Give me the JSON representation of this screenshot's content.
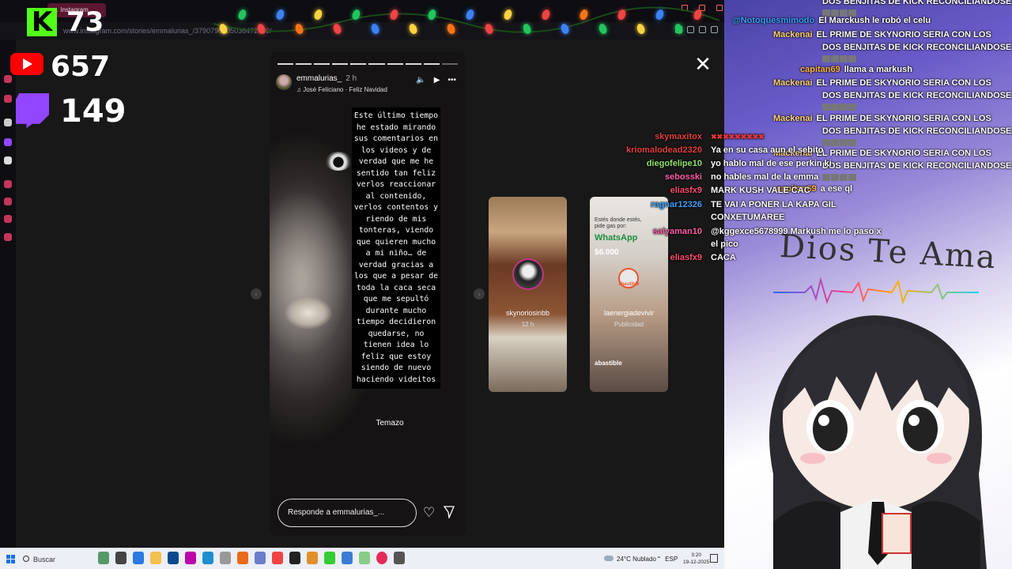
{
  "browser": {
    "tab_title": "… Instagram",
    "url": "www.instagram.com/stories/emmalurias_/3790790705036472569/"
  },
  "story": {
    "username": "emmalurias_",
    "time": "2 h",
    "music": "José Feliciano · Feliz Navidad",
    "caption": "Este último tiempo he estado mirando sus comentarios en los videos y de verdad que me he sentido tan feliz verlos reaccionar al contenido, verlos contentos y riendo de mis tonteras, viendo que quieren mucho a mi niño… de verdad gracias a los que a pesar de toda la caca seca que me sepultó durante mucho tiempo decidieron quedarse, no tienen idea lo feliz que estoy siendo de nuevo haciendo videitos",
    "tag_text": "Temazo",
    "reply_placeholder": "Responde a emmalurias_...",
    "progress_segments": 10,
    "progress_active": 9
  },
  "previews": [
    {
      "name": "skynoriosinbb",
      "sub": "12 h"
    },
    {
      "name": "laenergiadevivir",
      "sub": "Publicidad",
      "ad_small": "Estés donde estés, pide gas por:",
      "ad_title": "WhatsApp",
      "ad_brand": "abastible",
      "ad_price": "6.000",
      "ad_logo": "abastible"
    }
  ],
  "stream": {
    "kick_letter": "K",
    "kick_count": "73",
    "youtube_count": "657",
    "twitch_count": "149",
    "colors": {
      "kick": "#53fc18",
      "youtube": "#ff0000",
      "twitch": "#9146ff"
    }
  },
  "chat": [
    {
      "user": "",
      "text": "DOS BENJITAS DE KICK RECONCILIANDOSE",
      "color": "#ffffff"
    },
    {
      "user": "@Notoquesmimodo",
      "text": "El Marckush le robó el celu",
      "color": "#3aa0ff"
    },
    {
      "user": "Mackenai",
      "text": "EL PRIME DE SKYNORIO SERIA CON LOS",
      "color": "#ffd37a"
    },
    {
      "user": "",
      "text": "DOS BENJITAS DE KICK RECONCILIANDOSE",
      "color": "#ffffff"
    },
    {
      "user": "capitan69",
      "text": "llama a markush",
      "color": "#ffb347"
    },
    {
      "user": "Mackenai",
      "text": "EL PRIME DE SKYNORIO SERIA CON LOS",
      "color": "#ffd37a"
    },
    {
      "user": "",
      "text": "DOS BENJITAS DE KICK RECONCILIANDOSE",
      "color": "#ffffff"
    },
    {
      "user": "Mackenai",
      "text": "EL PRIME DE SKYNORIO SERIA CON LOS",
      "color": "#ffd37a"
    },
    {
      "user": "",
      "text": "DOS BENJITAS DE KICK RECONCILIANDOSE",
      "color": "#ffffff"
    },
    {
      "user": "Mackenai",
      "text": "EL PRIME DE SKYNORIO SERIA CON LOS",
      "color": "#ffd37a"
    },
    {
      "user": "",
      "text": "DOS BENJITAS DE KICK RECONCILIANDOSE",
      "color": "#ffffff"
    },
    {
      "user": "capitan69",
      "text": "a ese ql",
      "color": "#ffb347"
    }
  ],
  "chat2": [
    {
      "user": "skymaxitox",
      "text": "",
      "color": "#e0403a"
    },
    {
      "user": "kriomalodead2320",
      "text": "Ya en su casa aun el sebito",
      "color": "#e0403a"
    },
    {
      "user": "diegofelipe10",
      "text": "yo hablo mal de ese perkin ki",
      "color": "#8fe36b"
    },
    {
      "user": "sebosski",
      "text": "no hables mal de la emma",
      "color": "#ff5fa8"
    },
    {
      "user": "eliasfx9",
      "text": "MARK KUSH VALE CAC",
      "color": "#ff4b6e"
    },
    {
      "user": "ragnar12326",
      "text": "TE VAI A PONER LA KAPA GIL",
      "color": "#3aa0ff"
    },
    {
      "user": "",
      "text": "CONXETUMAREE",
      "color": "#ffffff"
    },
    {
      "user": "saiyaman10",
      "text": "@kggexce5678999 Markush me lo paso x",
      "color": "#ff5fa8"
    },
    {
      "user": "",
      "text": "el pico",
      "color": "#ffffff"
    },
    {
      "user": "eliasfx9",
      "text": "CACA",
      "color": "#ff4b6e"
    }
  ],
  "overlay_text": {
    "dios": "Dios Te Ama"
  },
  "taskbar": {
    "search": "Buscar",
    "weather": "24°C  Nublado",
    "lang": "ESP",
    "time": "3:20",
    "date": "19-12-2025"
  }
}
